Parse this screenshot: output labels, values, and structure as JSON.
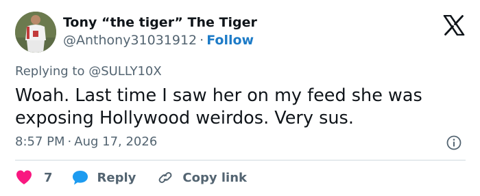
{
  "author": {
    "display_name": "Tony “the tiger” The Tiger",
    "handle": "@Anthony31031912",
    "separator": "·",
    "follow_label": "Follow",
    "avatar_icon": "football-player-avatar"
  },
  "platform_icon": "x-logo-icon",
  "reply_context": {
    "prefix": "Replying to ",
    "mention": "@SULLY10X"
  },
  "tweet": {
    "text": "Woah. Last time I saw her on my feed she was exposing Hollywood weirdos. Very sus."
  },
  "meta": {
    "time": "8:57 PM",
    "separator": "·",
    "date": "Aug 17, 2026",
    "info_icon": "info-icon"
  },
  "actions": {
    "like_count": "7",
    "reply_label": "Reply",
    "copy_label": "Copy link"
  },
  "colors": {
    "like": "#f91880",
    "reply": "#1d9bf0",
    "follow": "#1d7bc7",
    "secondary_text": "#536471"
  }
}
